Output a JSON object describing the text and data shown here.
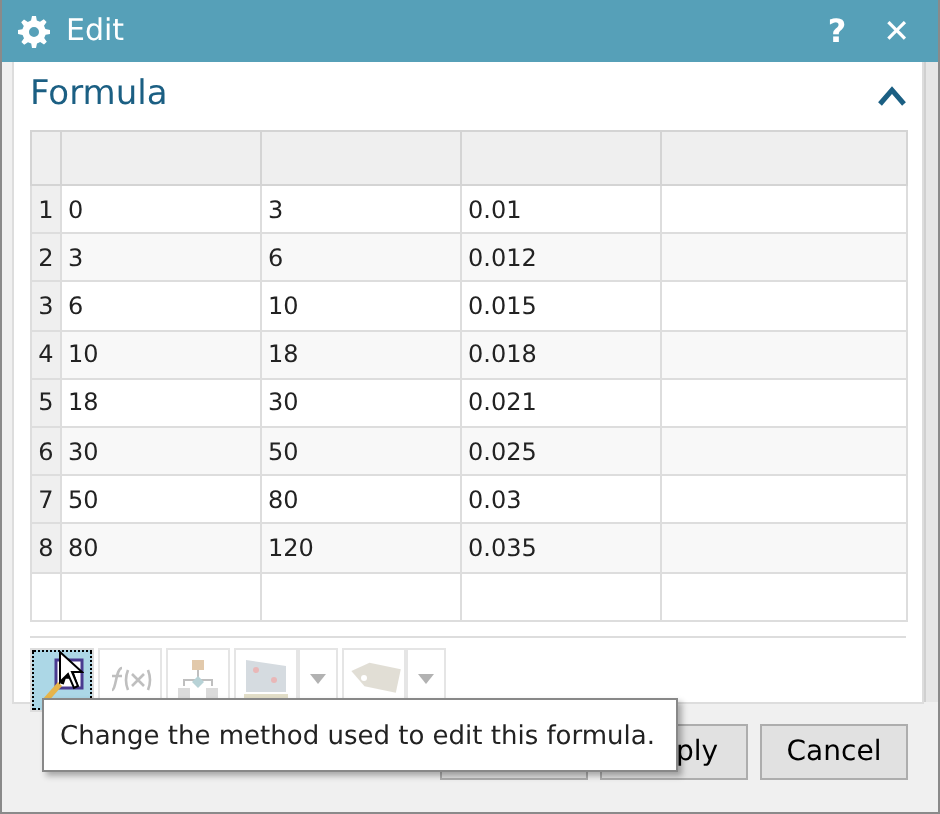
{
  "window": {
    "title": "Edit",
    "help": "?",
    "close": "✕"
  },
  "section": {
    "title": "Formula",
    "expanded": true
  },
  "table": {
    "rows": [
      {
        "number": "1",
        "cells": [
          "0",
          "3",
          "0.01",
          ""
        ]
      },
      {
        "number": "2",
        "cells": [
          "3",
          "6",
          "0.012",
          ""
        ]
      },
      {
        "number": "3",
        "cells": [
          "6",
          "10",
          "0.015",
          ""
        ]
      },
      {
        "number": "4",
        "cells": [
          "10",
          "18",
          "0.018",
          ""
        ]
      },
      {
        "number": "5",
        "cells": [
          "18",
          "30",
          "0.021",
          ""
        ]
      },
      {
        "number": "6",
        "cells": [
          "30",
          "50",
          "0.025",
          ""
        ]
      },
      {
        "number": "7",
        "cells": [
          "50",
          "80",
          "0.03",
          ""
        ]
      },
      {
        "number": "8",
        "cells": [
          "80",
          "120",
          "0.035",
          ""
        ]
      }
    ]
  },
  "toolbar": [
    {
      "kind": "method",
      "disabled": false,
      "selected": true
    },
    {
      "kind": "function",
      "disabled": true,
      "selected": false
    },
    {
      "kind": "tree",
      "disabled": true,
      "selected": false
    },
    {
      "kind": "measure",
      "disabled": true,
      "selected": false
    },
    {
      "kind": "dropdown",
      "disabled": true,
      "selected": false
    },
    {
      "kind": "tag",
      "disabled": true,
      "selected": false
    },
    {
      "kind": "dropdown",
      "disabled": true,
      "selected": false
    }
  ],
  "tooltip": "Change the method used to edit this formula.",
  "buttons": [
    {
      "label": "ply"
    },
    {
      "label": "Cancel"
    }
  ]
}
